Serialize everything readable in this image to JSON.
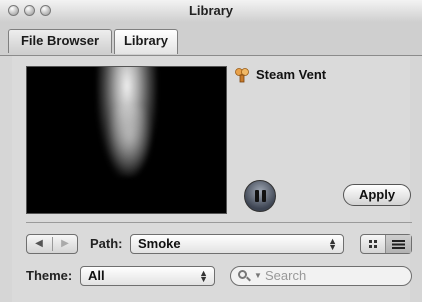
{
  "window": {
    "title": "Library"
  },
  "tabs": [
    {
      "label": "File Browser",
      "active": false
    },
    {
      "label": "Library",
      "active": true
    }
  ],
  "item": {
    "name": "Steam Vent",
    "icon": "steam-particle-icon"
  },
  "playback": {
    "state": "playing",
    "icon": "pause-icon"
  },
  "apply_label": "Apply",
  "navigation": {
    "back_icon": "back-arrow-icon",
    "forward_icon": "forward-arrow-icon",
    "path_label": "Path:",
    "path_value": "Smoke"
  },
  "view_toggle": {
    "options": [
      "icon-view",
      "list-view"
    ],
    "selected": "list-view"
  },
  "theme": {
    "label": "Theme:",
    "value": "All"
  },
  "search": {
    "placeholder": "Search"
  },
  "colors": {
    "window_bg": "#d6d6d6",
    "preview_bg": "#000000",
    "accent_pause": "#3d4452"
  }
}
